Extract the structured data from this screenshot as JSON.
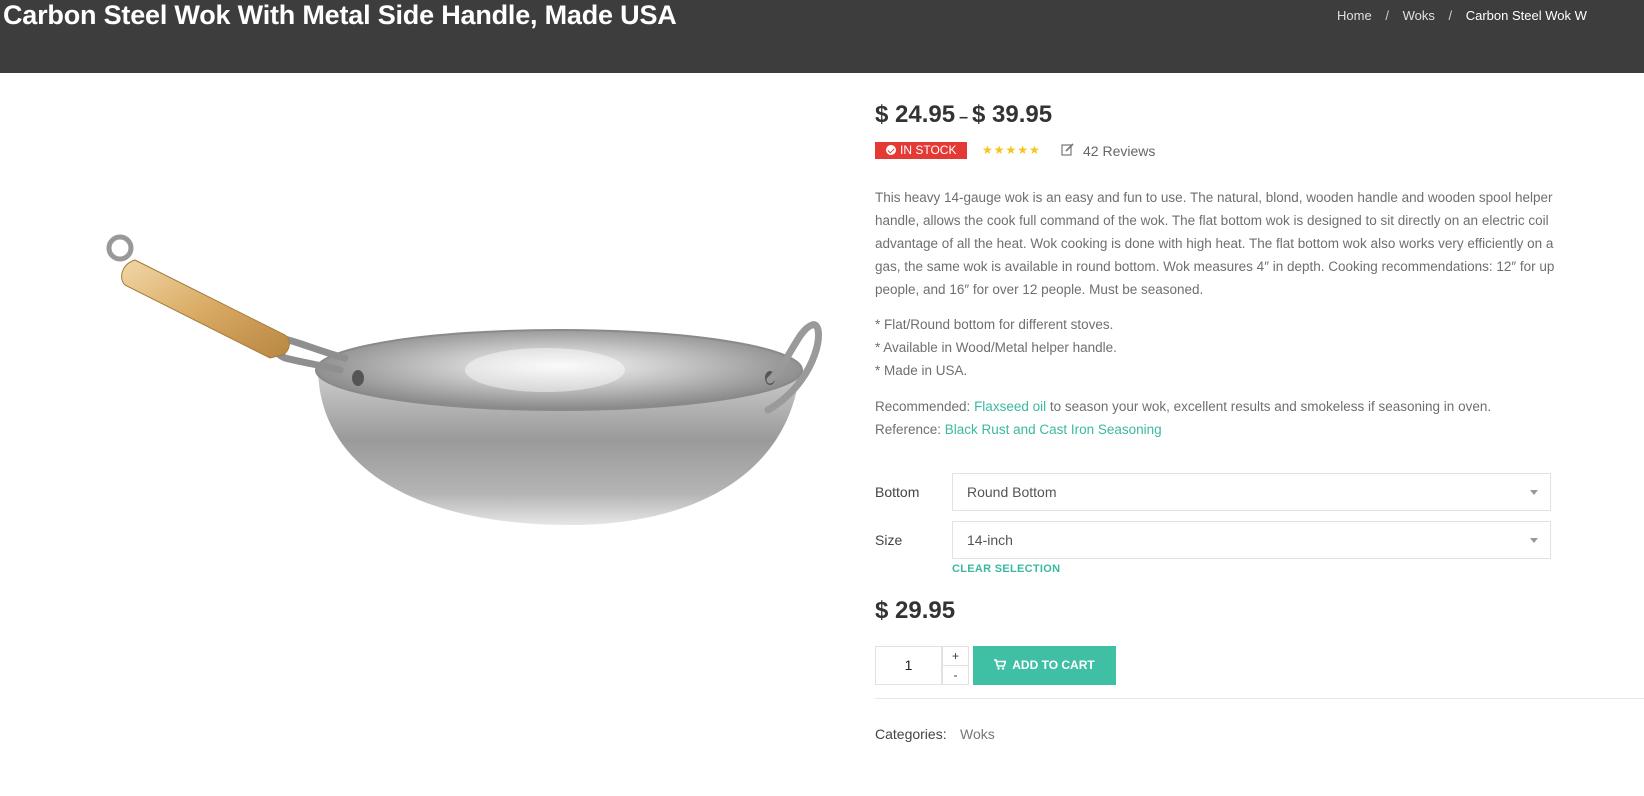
{
  "header": {
    "title": "Carbon Steel Wok With Metal Side Handle, Made USA",
    "breadcrumb": [
      "Home",
      "Woks",
      "Carbon Steel Wok W"
    ],
    "separator": "/"
  },
  "product": {
    "price_min": "$ 24.95",
    "price_dash": "–",
    "price_max": "$ 39.95",
    "stock_label": "IN STOCK",
    "rating_stars": "★★★★★",
    "reviews_label": "42 Reviews",
    "description_lines": [
      "This heavy 14-gauge wok is an easy and fun to use. The natural, blond, wooden handle and wooden spool helper",
      "handle, allows the cook full command of the wok. The flat bottom wok is designed to sit directly on an electric coil",
      "advantage of all the heat. Wok cooking is done with high heat. The flat bottom wok also works very efficiently on a",
      "gas, the same wok is available in round bottom. Wok measures 4″ in depth. Cooking recommendations: 12″ for up",
      "people, and 16″ for over 12 people. Must be seasoned."
    ],
    "features": [
      "* Flat/Round bottom for different stoves.",
      "* Available in Wood/Metal helper handle.",
      "* Made in USA."
    ],
    "recommended": {
      "prefix": "Recommended: ",
      "link": "Flaxseed oil",
      "suffix": " to season your wok, excellent results and smokeless if seasoning in oven."
    },
    "reference": {
      "prefix": "Reference: ",
      "link": "Black Rust and Cast Iron Seasoning"
    },
    "variations": {
      "bottom_label": "Bottom",
      "bottom_value": "Round Bottom",
      "size_label": "Size",
      "size_value": "14-inch",
      "clear_label": "CLEAR SELECTION"
    },
    "variation_price": "$ 29.95",
    "quantity": "1",
    "qty_plus": "+",
    "qty_minus": "-",
    "add_to_cart_label": "ADD TO CART",
    "categories_label": "Categories:",
    "categories_value": "Woks"
  },
  "colors": {
    "header_bg": "#3d3d3d",
    "accent": "#3fbfa4",
    "stock_badge": "#e53935",
    "stars": "#f5c518"
  },
  "icons": {
    "stock": "check-circle-icon",
    "review": "edit-icon",
    "cart": "cart-icon",
    "select": "chevron-down-icon"
  }
}
